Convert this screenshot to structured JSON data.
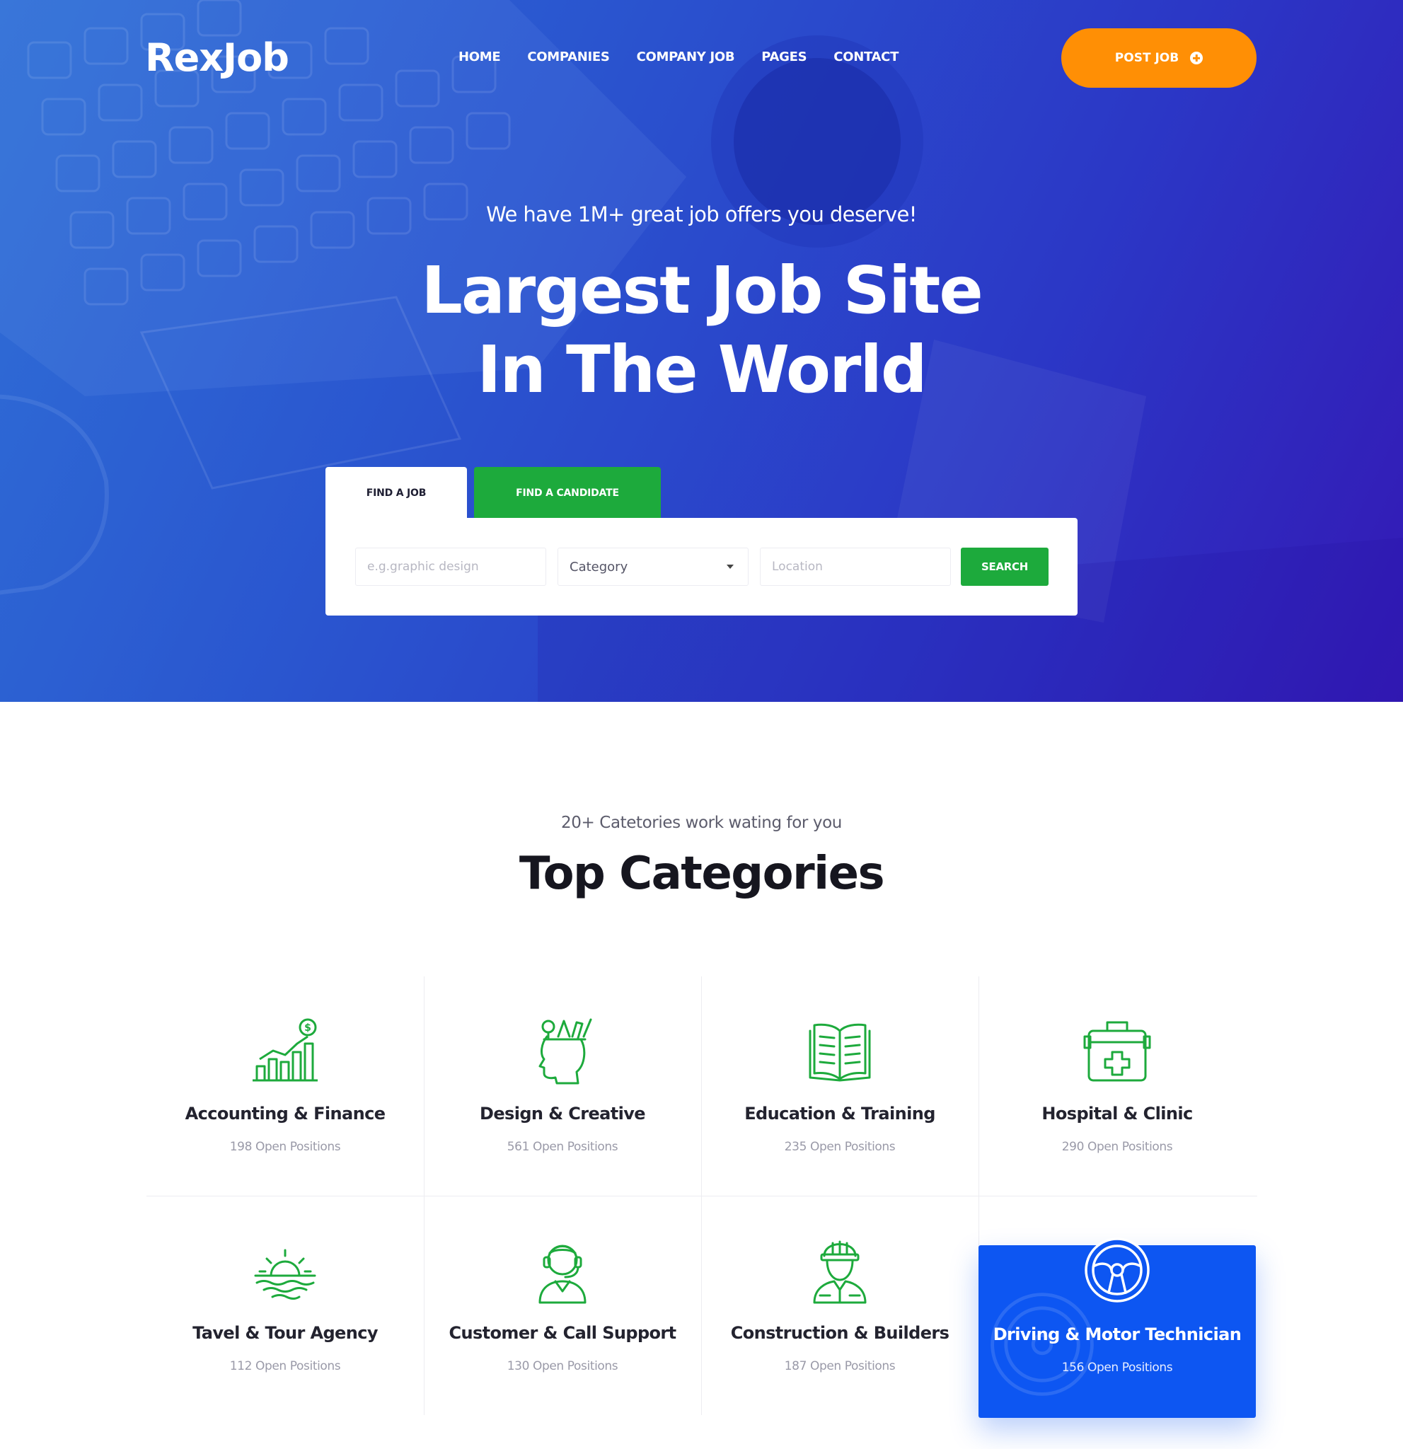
{
  "brand": {
    "logo": "RexJob",
    "accent_orange": "#ff8f05",
    "accent_green": "#1daa3c",
    "accent_blue": "#0d56f2"
  },
  "nav": {
    "items": [
      "HOME",
      "COMPANIES",
      "COMPANY JOB",
      "PAGES",
      "CONTACT"
    ],
    "post_job": "POST JOB",
    "post_job_icon": "plus-circle-icon"
  },
  "hero": {
    "tagline": "We have 1M+ great job offers you deserve!",
    "headline_line1": "Largest Job Site",
    "headline_line2": "In The World"
  },
  "search": {
    "tabs": [
      "FIND A JOB",
      "FIND A CANDIDATE"
    ],
    "active_tab": "FIND A JOB",
    "keyword_placeholder": "e.g.graphic design",
    "category_value": "Category",
    "location_placeholder": "Location",
    "button": "SEARCH"
  },
  "categories": {
    "subtitle": "20+ Catetories work wating for you",
    "title": "Top Categories",
    "items": [
      {
        "name": "Accounting & Finance",
        "count": "198 Open Positions",
        "icon": "finance-chart-icon"
      },
      {
        "name": "Design & Creative",
        "count": "561 Open Positions",
        "icon": "creative-head-icon"
      },
      {
        "name": "Education & Training",
        "count": "235 Open Positions",
        "icon": "open-book-icon"
      },
      {
        "name": "Hospital & Clinic",
        "count": "290 Open Positions",
        "icon": "medical-kit-icon"
      },
      {
        "name": "Tavel & Tour Agency",
        "count": "112 Open Positions",
        "icon": "sunset-icon"
      },
      {
        "name": "Customer & Call Support",
        "count": "130 Open Positions",
        "icon": "support-agent-icon"
      },
      {
        "name": "Construction & Builders",
        "count": "187 Open Positions",
        "icon": "builder-icon"
      },
      {
        "name": "Driving & Motor Technician",
        "count": "156 Open Positions",
        "icon": "steering-wheel-icon",
        "active": true
      }
    ]
  }
}
